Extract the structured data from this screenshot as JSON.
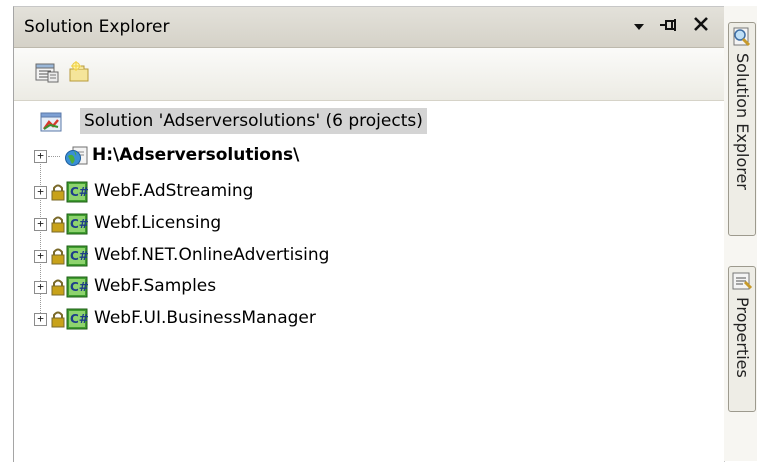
{
  "panel": {
    "title": "Solution Explorer",
    "title_buttons": {
      "dropdown": "▾",
      "pin": "⊣",
      "close": "✕"
    }
  },
  "toolbar": {
    "buttons": [
      {
        "icon": "properties-icon"
      },
      {
        "icon": "show-all-files-icon"
      }
    ]
  },
  "tree": {
    "solution": {
      "label": "Solution 'Adserversolutions' (6 projects)",
      "icon": "solution-icon"
    },
    "items": [
      {
        "label": "H:\\Adserversolutions\\",
        "bold": true,
        "icon": "website-icon",
        "expander": "+"
      },
      {
        "label": "WebF.AdStreaming",
        "bold": false,
        "icon": "csharp-project-icon",
        "lock": true,
        "expander": "+"
      },
      {
        "label": "Webf.Licensing",
        "bold": false,
        "icon": "csharp-project-icon",
        "lock": true,
        "expander": "+"
      },
      {
        "label": "Webf.NET.OnlineAdvertising",
        "bold": false,
        "icon": "csharp-project-icon",
        "lock": true,
        "expander": "+"
      },
      {
        "label": "WebF.Samples",
        "bold": false,
        "icon": "csharp-project-icon",
        "lock": true,
        "expander": "+"
      },
      {
        "label": "WebF.UI.BusinessManager",
        "bold": false,
        "icon": "csharp-project-icon",
        "lock": true,
        "expander": "+"
      }
    ]
  },
  "side_tabs": [
    {
      "label": "Solution Explorer",
      "icon": "solution-explorer-icon"
    },
    {
      "label": "Properties",
      "icon": "properties-icon"
    }
  ],
  "colors": {
    "selection": "#d4d4d4",
    "csharp_green": "#3f9d2f",
    "lock_gold": "#c8a21a"
  }
}
